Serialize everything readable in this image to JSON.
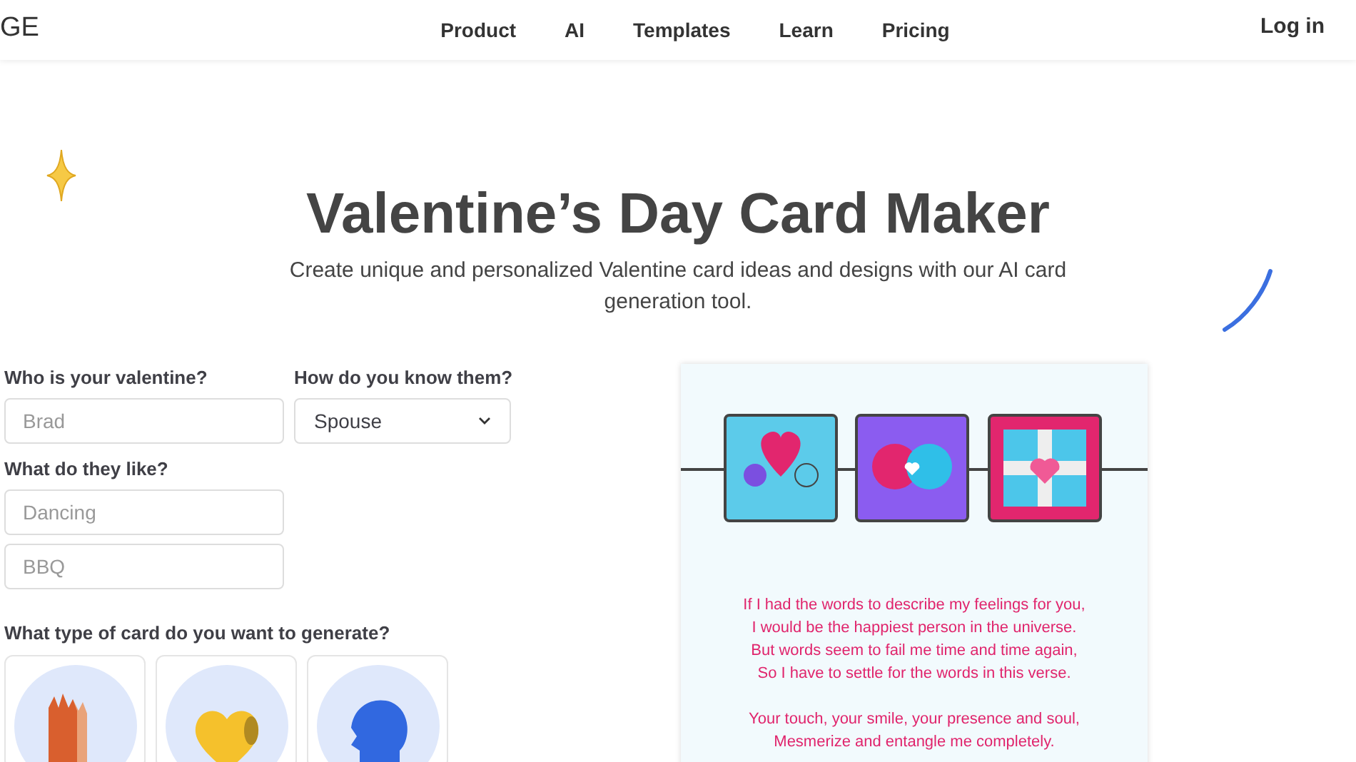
{
  "header": {
    "logo": "GE",
    "nav": [
      "Product",
      "AI",
      "Templates",
      "Learn",
      "Pricing"
    ],
    "login": "Log in"
  },
  "hero": {
    "title": "Valentine’s Day Card Maker",
    "subtitle": "Create unique and personalized Valentine card ideas and designs with our AI card generation tool."
  },
  "form": {
    "valentine_label": "Who is your valentine?",
    "valentine_placeholder": "Brad",
    "relation_label": "How do you know them?",
    "relation_value": "Spouse",
    "likes_label": "What do they like?",
    "likes_placeholders": [
      "Dancing",
      "BBQ"
    ],
    "card_type_label": "What type of card do you want to generate?"
  },
  "preview": {
    "stanzas": [
      [
        "If I had the words to describe my feelings for you,",
        "I would be the happiest person in the universe.",
        "But words seem to fail me time and time again,",
        "So I have to settle for the words in this verse."
      ],
      [
        "Your touch, your smile, your presence and soul,",
        "Mesmerize and entangle me completely."
      ]
    ]
  }
}
